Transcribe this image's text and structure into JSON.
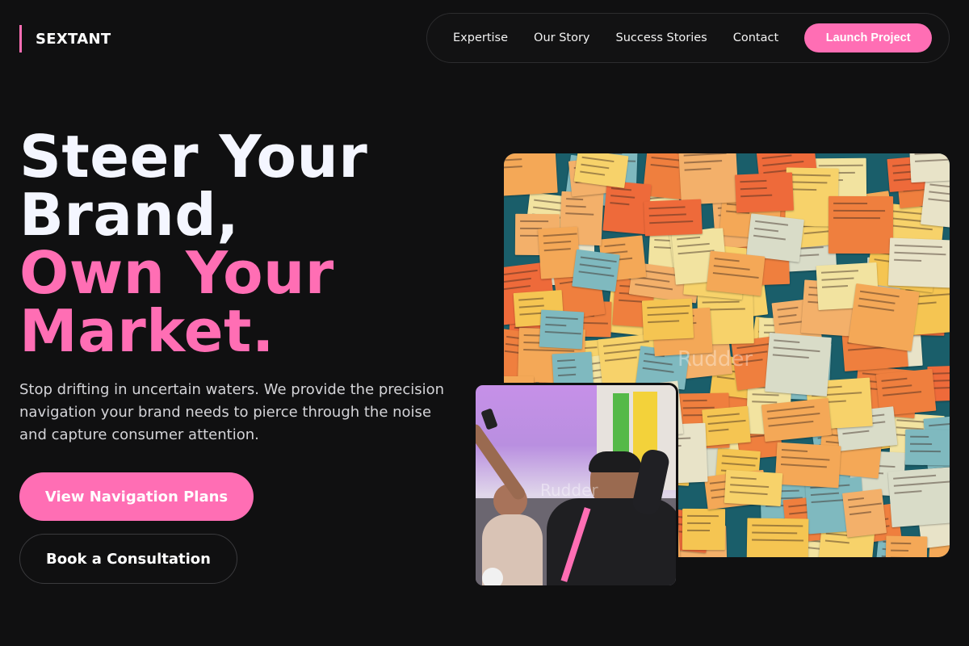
{
  "brand": {
    "name": "SEXTANT",
    "accent": "#ff6eb4"
  },
  "nav": {
    "items": [
      "Expertise",
      "Our Story",
      "Success Stories",
      "Contact"
    ],
    "cta": "Launch Project"
  },
  "hero": {
    "title_line1": "Steer Your",
    "title_line2": "Brand,",
    "title_line3": "Own Your",
    "title_line4": "Market.",
    "subtitle": "Stop drifting in uncertain waters. We provide the precision navigation your brand needs to pierce through the noise and capture consumer attention.",
    "primary_button": "View Navigation Plans",
    "secondary_button": "Book a Consultation"
  },
  "images": {
    "main": {
      "name": "sticky-notes-wall-photo",
      "watermark": "Rudder"
    },
    "secondary": {
      "name": "selfie-crowd-photo",
      "watermark": "Rudder"
    }
  },
  "colors": {
    "background": "#101011",
    "accent": "#ff6eb4",
    "text": "#ffffff"
  }
}
